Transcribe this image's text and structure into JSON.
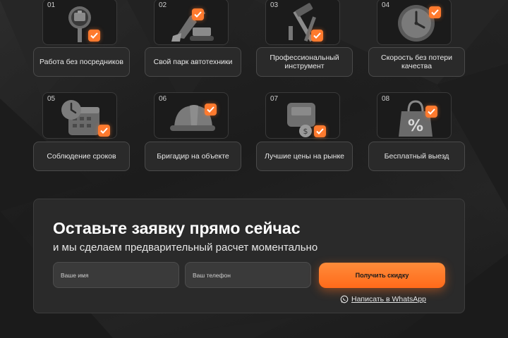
{
  "features": [
    {
      "num": "01",
      "label": "Работа без посредников",
      "icon": "handshake-briefcase-icon"
    },
    {
      "num": "02",
      "label": "Свой парк автотехники",
      "icon": "excavator-icon"
    },
    {
      "num": "03",
      "label": "Профессиональный инструмент",
      "icon": "hammer-tools-icon"
    },
    {
      "num": "04",
      "label": "Скорость без потери качества",
      "icon": "clock-icon"
    },
    {
      "num": "05",
      "label": "Соблюдение сроков",
      "icon": "calendar-clock-icon"
    },
    {
      "num": "06",
      "label": "Бригадир на объекте",
      "icon": "hard-hat-icon"
    },
    {
      "num": "07",
      "label": "Лучшие цены на рынке",
      "icon": "wallet-coins-icon"
    },
    {
      "num": "08",
      "label": "Бесплатный выезд",
      "icon": "discount-bag-icon"
    }
  ],
  "form": {
    "title": "Оставьте заявку прямо сейчас",
    "subtitle": "и мы сделаем предварительный расчет моментально",
    "name_placeholder": "Ваше имя",
    "phone_placeholder": "Ваш телефон",
    "submit_label": "Получить скидку",
    "whatsapp_label": "Написать в WhatsApp"
  },
  "colors": {
    "accent": "#ff7a2e",
    "background": "#1f1f1f",
    "card": "#2a2a2a"
  }
}
